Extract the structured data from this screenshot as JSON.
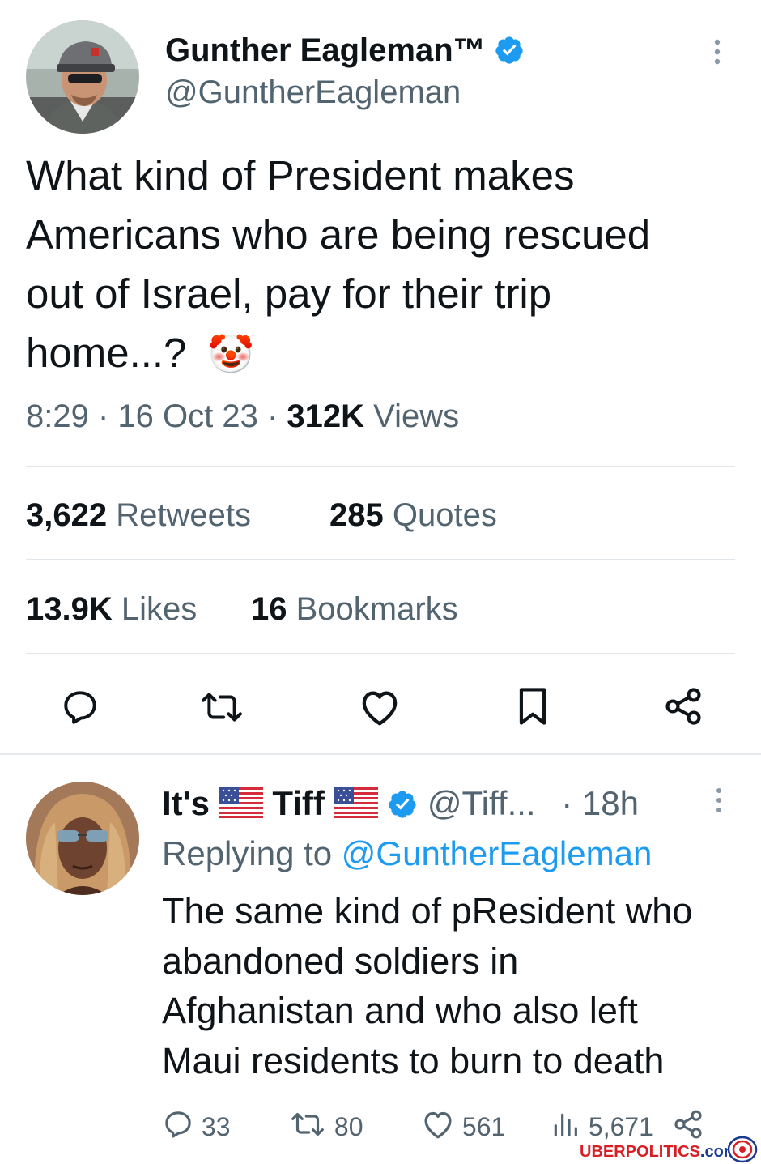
{
  "tweet": {
    "author_name": "Gunther Eagleman™",
    "author_handle": "@GuntherEagleman",
    "text_lines": [
      "What kind of President makes",
      "Americans who are being rescued",
      "out of Israel,  pay for their trip",
      "home...?"
    ],
    "emoji": "🤡",
    "time": "8:29",
    "date": "16 Oct 23",
    "views_count": "312K",
    "views_label": "Views",
    "retweets_count": "3,622",
    "retweets_label": "Retweets",
    "quotes_count": "285",
    "quotes_label": "Quotes",
    "likes_count": "13.9K",
    "likes_label": "Likes",
    "bookmarks_count": "16",
    "bookmarks_label": "Bookmarks",
    "action_icons": [
      "reply-icon",
      "retweet-icon",
      "like-icon",
      "bookmark-icon",
      "share-icon"
    ]
  },
  "reply": {
    "name_part1": "It's",
    "name_part2": "Tiff",
    "handle": "@Tiff...",
    "time": "· 18h",
    "replying_label": "Replying to",
    "replying_handle": "@GuntherEagleman",
    "text_lines": [
      "The same kind of pResident who",
      "abandoned soldiers in",
      "Afghanistan and who also left",
      "Maui residents to burn to death"
    ],
    "reply_count": "33",
    "retweet_count": "80",
    "like_count": "561",
    "views_count": "5,671"
  },
  "watermark": {
    "brand_a": "UBER",
    "brand_b": "POLITICS",
    "brand_c": ".com"
  },
  "colors": {
    "verified": "#1d9bf0",
    "muted": "#536471",
    "text": "#0f1419",
    "link": "#1d9bf0",
    "watermark_red": "#d81f26",
    "watermark_blue": "#1a3a8f"
  }
}
